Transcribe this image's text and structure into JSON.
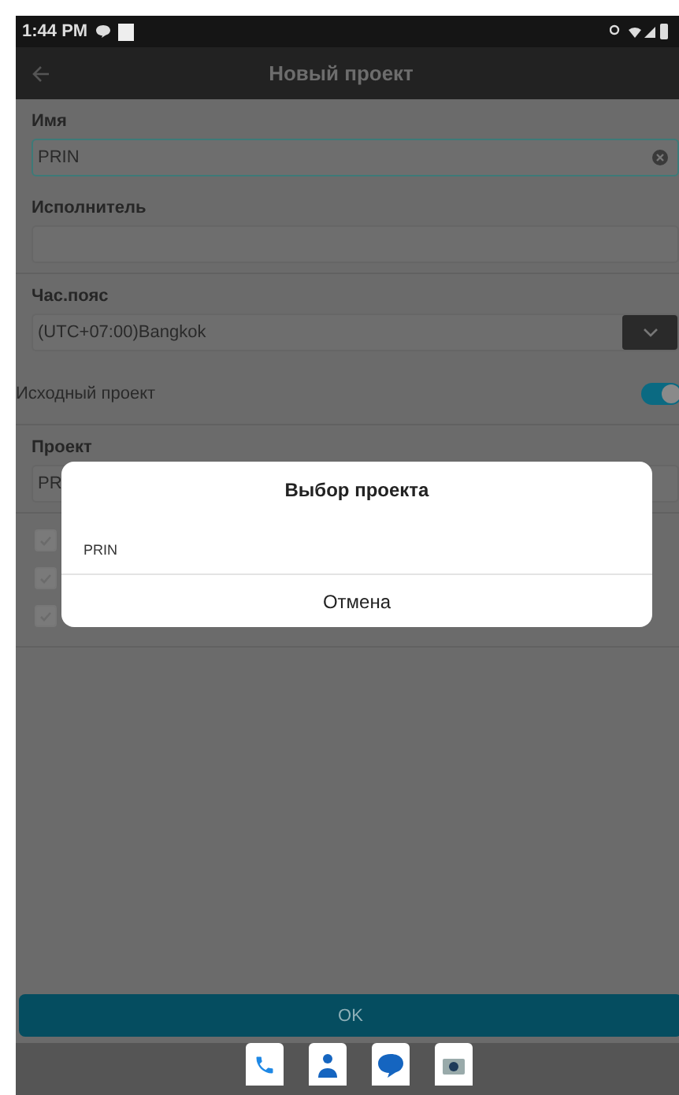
{
  "status_bar": {
    "time": "1:44 PM"
  },
  "app_bar": {
    "title": "Новый проект"
  },
  "form": {
    "name": {
      "label": "Имя",
      "value": "PRIN"
    },
    "performer": {
      "label": "Исполнитель"
    },
    "timezone": {
      "label": "Час.пояс",
      "value": "(UTC+07:00)Bangkok"
    },
    "source_project": {
      "label": "Исходный проект",
      "on": true
    },
    "project": {
      "label": "Проект",
      "value": "PR"
    },
    "options": [
      {
        "checked": true
      },
      {
        "checked": true
      },
      {
        "checked": true
      }
    ]
  },
  "ok_button": {
    "label": "OK",
    "disabled": true
  },
  "dialog": {
    "title": "Выбор проекта",
    "items": [
      {
        "label": "PRIN"
      }
    ],
    "cancel": "Отмена"
  },
  "dock": [
    {
      "kind": "phone"
    },
    {
      "kind": "contacts"
    },
    {
      "kind": "messages"
    },
    {
      "kind": "camera"
    }
  ]
}
